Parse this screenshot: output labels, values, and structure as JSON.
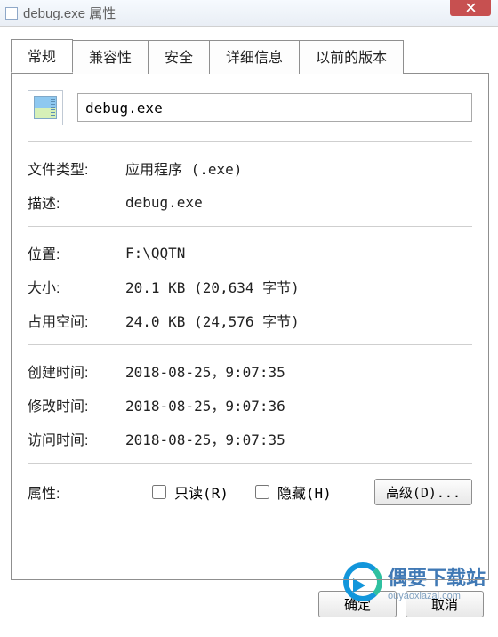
{
  "window": {
    "title": "debug.exe 属性"
  },
  "tabs": {
    "general": "常规",
    "compat": "兼容性",
    "security": "安全",
    "details": "详细信息",
    "prev": "以前的版本"
  },
  "general": {
    "filename": "debug.exe",
    "type_label": "文件类型:",
    "type_value": "应用程序 (.exe)",
    "desc_label": "描述:",
    "desc_value": "debug.exe",
    "loc_label": "位置:",
    "loc_value": "F:\\QQTN",
    "size_label": "大小:",
    "size_value": "20.1 KB (20,634 字节)",
    "disk_label": "占用空间:",
    "disk_value": "24.0 KB (24,576 字节)",
    "ctime_label": "创建时间:",
    "ctime_value": "2018-08-25，9:07:35",
    "mtime_label": "修改时间:",
    "mtime_value": "2018-08-25，9:07:36",
    "atime_label": "访问时间:",
    "atime_value": "2018-08-25，9:07:35",
    "attr_label": "属性:",
    "readonly_label": "只读(R)",
    "hidden_label": "隐藏(H)",
    "advanced_label": "高级(D)..."
  },
  "buttons": {
    "ok": "确定",
    "cancel": "取消"
  },
  "watermark": {
    "name": "偶要下载站",
    "url": "ouyaoxiazai.com"
  }
}
